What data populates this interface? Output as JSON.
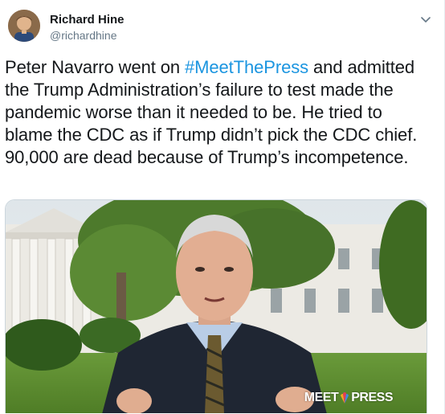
{
  "user": {
    "display_name": "Richard Hine",
    "handle": "@richardhine"
  },
  "tweet": {
    "text_before": "Peter Navarro went on ",
    "hashtag": "#MeetThePress",
    "text_after": " and admitted the Trump Administration’s failure to test made the pandemic worse than it needed to be. He tried to blame the CDC as if Trump didn’t pick the CDC chief. 90,000 are dead because of Trump’s incompetence."
  },
  "media": {
    "logo_left": "MEET",
    "logo_right": "PRESS"
  },
  "icons": {
    "menu": "chevron-down-icon",
    "avatar": "avatar"
  },
  "colors": {
    "link": "#1b95e0",
    "secondary_text": "#657786",
    "primary_text": "#14171a"
  }
}
